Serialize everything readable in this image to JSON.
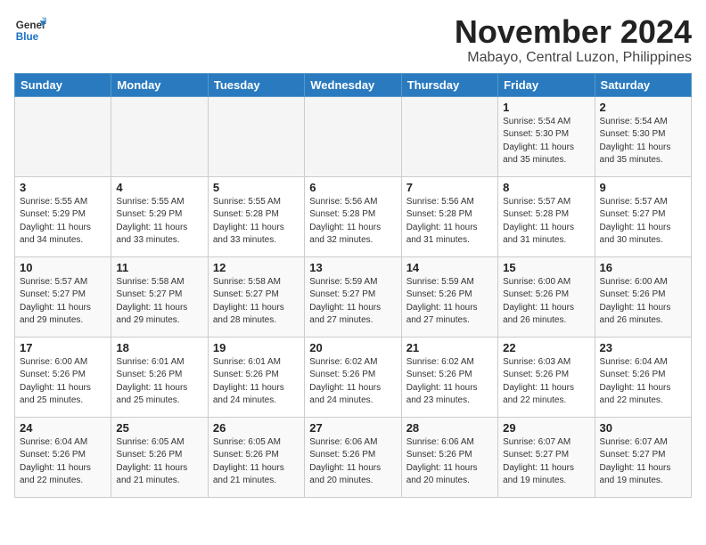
{
  "header": {
    "logo_line1": "General",
    "logo_line2": "Blue",
    "month": "November 2024",
    "location": "Mabayo, Central Luzon, Philippines"
  },
  "weekdays": [
    "Sunday",
    "Monday",
    "Tuesday",
    "Wednesday",
    "Thursday",
    "Friday",
    "Saturday"
  ],
  "weeks": [
    [
      {
        "day": "",
        "info": ""
      },
      {
        "day": "",
        "info": ""
      },
      {
        "day": "",
        "info": ""
      },
      {
        "day": "",
        "info": ""
      },
      {
        "day": "",
        "info": ""
      },
      {
        "day": "1",
        "info": "Sunrise: 5:54 AM\nSunset: 5:30 PM\nDaylight: 11 hours\nand 35 minutes."
      },
      {
        "day": "2",
        "info": "Sunrise: 5:54 AM\nSunset: 5:30 PM\nDaylight: 11 hours\nand 35 minutes."
      }
    ],
    [
      {
        "day": "3",
        "info": "Sunrise: 5:55 AM\nSunset: 5:29 PM\nDaylight: 11 hours\nand 34 minutes."
      },
      {
        "day": "4",
        "info": "Sunrise: 5:55 AM\nSunset: 5:29 PM\nDaylight: 11 hours\nand 33 minutes."
      },
      {
        "day": "5",
        "info": "Sunrise: 5:55 AM\nSunset: 5:28 PM\nDaylight: 11 hours\nand 33 minutes."
      },
      {
        "day": "6",
        "info": "Sunrise: 5:56 AM\nSunset: 5:28 PM\nDaylight: 11 hours\nand 32 minutes."
      },
      {
        "day": "7",
        "info": "Sunrise: 5:56 AM\nSunset: 5:28 PM\nDaylight: 11 hours\nand 31 minutes."
      },
      {
        "day": "8",
        "info": "Sunrise: 5:57 AM\nSunset: 5:28 PM\nDaylight: 11 hours\nand 31 minutes."
      },
      {
        "day": "9",
        "info": "Sunrise: 5:57 AM\nSunset: 5:27 PM\nDaylight: 11 hours\nand 30 minutes."
      }
    ],
    [
      {
        "day": "10",
        "info": "Sunrise: 5:57 AM\nSunset: 5:27 PM\nDaylight: 11 hours\nand 29 minutes."
      },
      {
        "day": "11",
        "info": "Sunrise: 5:58 AM\nSunset: 5:27 PM\nDaylight: 11 hours\nand 29 minutes."
      },
      {
        "day": "12",
        "info": "Sunrise: 5:58 AM\nSunset: 5:27 PM\nDaylight: 11 hours\nand 28 minutes."
      },
      {
        "day": "13",
        "info": "Sunrise: 5:59 AM\nSunset: 5:27 PM\nDaylight: 11 hours\nand 27 minutes."
      },
      {
        "day": "14",
        "info": "Sunrise: 5:59 AM\nSunset: 5:26 PM\nDaylight: 11 hours\nand 27 minutes."
      },
      {
        "day": "15",
        "info": "Sunrise: 6:00 AM\nSunset: 5:26 PM\nDaylight: 11 hours\nand 26 minutes."
      },
      {
        "day": "16",
        "info": "Sunrise: 6:00 AM\nSunset: 5:26 PM\nDaylight: 11 hours\nand 26 minutes."
      }
    ],
    [
      {
        "day": "17",
        "info": "Sunrise: 6:00 AM\nSunset: 5:26 PM\nDaylight: 11 hours\nand 25 minutes."
      },
      {
        "day": "18",
        "info": "Sunrise: 6:01 AM\nSunset: 5:26 PM\nDaylight: 11 hours\nand 25 minutes."
      },
      {
        "day": "19",
        "info": "Sunrise: 6:01 AM\nSunset: 5:26 PM\nDaylight: 11 hours\nand 24 minutes."
      },
      {
        "day": "20",
        "info": "Sunrise: 6:02 AM\nSunset: 5:26 PM\nDaylight: 11 hours\nand 24 minutes."
      },
      {
        "day": "21",
        "info": "Sunrise: 6:02 AM\nSunset: 5:26 PM\nDaylight: 11 hours\nand 23 minutes."
      },
      {
        "day": "22",
        "info": "Sunrise: 6:03 AM\nSunset: 5:26 PM\nDaylight: 11 hours\nand 22 minutes."
      },
      {
        "day": "23",
        "info": "Sunrise: 6:04 AM\nSunset: 5:26 PM\nDaylight: 11 hours\nand 22 minutes."
      }
    ],
    [
      {
        "day": "24",
        "info": "Sunrise: 6:04 AM\nSunset: 5:26 PM\nDaylight: 11 hours\nand 22 minutes."
      },
      {
        "day": "25",
        "info": "Sunrise: 6:05 AM\nSunset: 5:26 PM\nDaylight: 11 hours\nand 21 minutes."
      },
      {
        "day": "26",
        "info": "Sunrise: 6:05 AM\nSunset: 5:26 PM\nDaylight: 11 hours\nand 21 minutes."
      },
      {
        "day": "27",
        "info": "Sunrise: 6:06 AM\nSunset: 5:26 PM\nDaylight: 11 hours\nand 20 minutes."
      },
      {
        "day": "28",
        "info": "Sunrise: 6:06 AM\nSunset: 5:26 PM\nDaylight: 11 hours\nand 20 minutes."
      },
      {
        "day": "29",
        "info": "Sunrise: 6:07 AM\nSunset: 5:27 PM\nDaylight: 11 hours\nand 19 minutes."
      },
      {
        "day": "30",
        "info": "Sunrise: 6:07 AM\nSunset: 5:27 PM\nDaylight: 11 hours\nand 19 minutes."
      }
    ]
  ]
}
